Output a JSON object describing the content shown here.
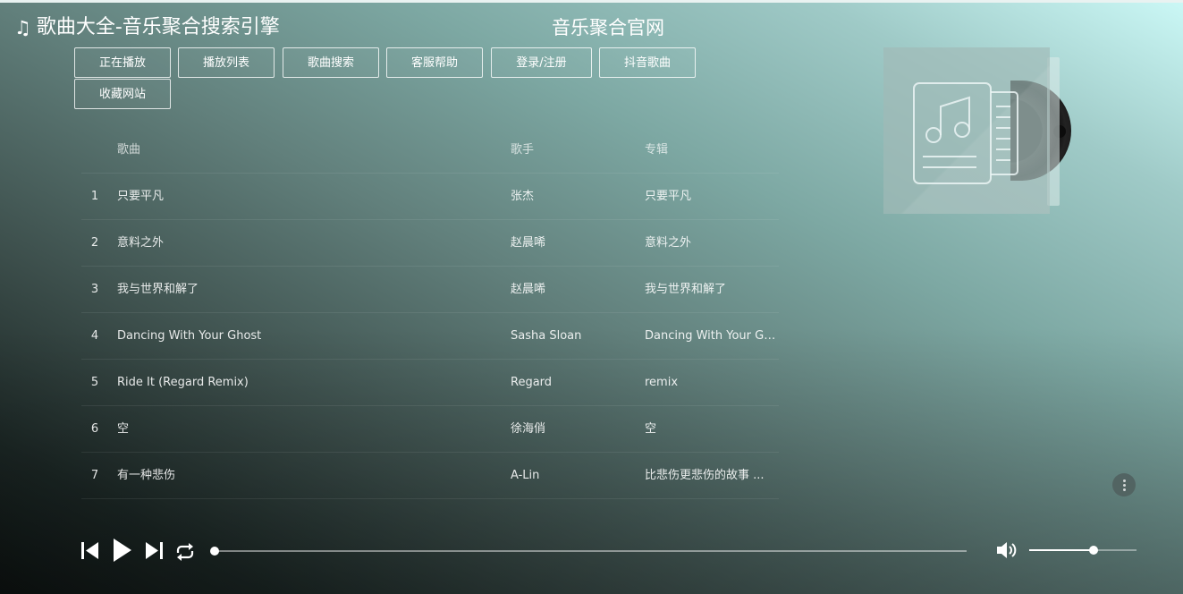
{
  "header": {
    "site_title": "歌曲大全-音乐聚合搜索引擎",
    "title_icon": "music-note-icon",
    "center_title": "音乐聚合官网"
  },
  "nav": {
    "buttons": [
      "正在播放",
      "播放列表",
      "歌曲搜索",
      "客服帮助",
      "登录/注册",
      "抖音歌曲",
      "收藏网站"
    ]
  },
  "playlist": {
    "columns": {
      "song": "歌曲",
      "artist": "歌手",
      "album": "专辑"
    },
    "rows": [
      {
        "num": "1",
        "song": "只要平凡",
        "artist": "张杰",
        "album": "只要平凡"
      },
      {
        "num": "2",
        "song": "意料之外",
        "artist": "赵晨唏",
        "album": "意料之外"
      },
      {
        "num": "3",
        "song": "我与世界和解了",
        "artist": "赵晨唏",
        "album": "我与世界和解了"
      },
      {
        "num": "4",
        "song": "Dancing With Your Ghost",
        "artist": "Sasha Sloan",
        "album": "Dancing With Your Gh..."
      },
      {
        "num": "5",
        "song": "Ride It (Regard Remix)",
        "artist": "Regard",
        "album": "remix"
      },
      {
        "num": "6",
        "song": "空",
        "artist": "徐海俏",
        "album": "空"
      },
      {
        "num": "7",
        "song": "有一种悲伤",
        "artist": "A-Lin",
        "album": "比悲伤更悲伤的故事 ..."
      }
    ]
  },
  "player": {
    "progress": 0.0,
    "volume": 0.6
  },
  "icons": {
    "prev": "skip-previous-icon",
    "play": "play-icon",
    "next": "skip-next-icon",
    "loop": "loop-icon",
    "volume": "volume-icon",
    "more": "more-vertical-icon",
    "cover": "music-document-icon"
  },
  "colors": {
    "gradient_top_right": "#cbf8f6",
    "gradient_bottom_left": "#0d1211",
    "text": "#ffffff"
  }
}
